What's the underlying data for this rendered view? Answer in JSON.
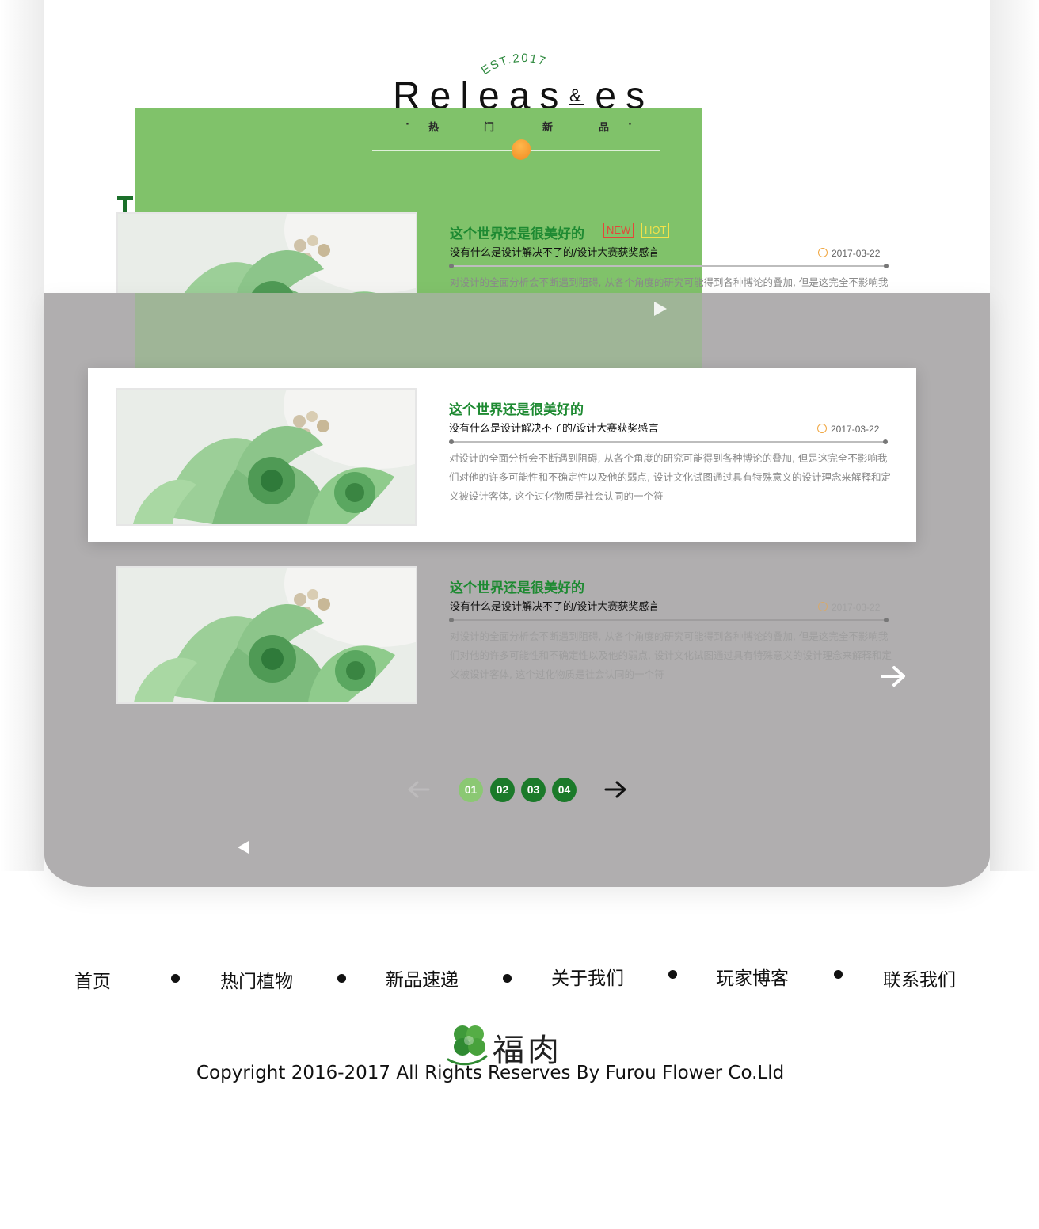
{
  "header": {
    "est": "EST.2017",
    "title": "Releas",
    "title_tail": "es",
    "ampersand": "&",
    "subtitle": [
      "·",
      "热",
      "门",
      "新",
      "品",
      "·"
    ]
  },
  "articles": [
    {
      "title": "这个世界还是很美好的",
      "subtitle": "没有什么是设计解决不了的/设计大赛获奖感言",
      "date": "2017-03-22",
      "description": "对设计的全面分析会不断遇到阻碍, 从各个角度的研究可能得到各种博论的叠加, 但是这完全不影响我们对他的许多可能性和不确定性以及他的弱点, 设计文化试图通过具有特殊意义的设计理念来解释和定义被设计客体, 这个过化物质是社会认同的一个符",
      "tags": [
        "NEW",
        "HOT"
      ]
    },
    {
      "title": "这个世界还是很美好的",
      "subtitle": "没有什么是设计解决不了的/设计大赛获奖感言",
      "date": "2017-03-22",
      "description": "对设计的全面分析会不断遇到阻碍, 从各个角度的研究可能得到各种博论的叠加, 但是这完全不影响我们对他的许多可能性和不确定性以及他的弱点, 设计文化试图通过具有特殊意义的设计理念来解释和定义被设计客体, 这个过化物质是社会认同的一个符",
      "tags": []
    },
    {
      "title": "这个世界还是很美好的",
      "subtitle": "没有什么是设计解决不了的/设计大赛获奖感言",
      "date": "2017-03-22",
      "description": "对设计的全面分析会不断遇到阻碍, 从各个角度的研究可能得到各种博论的叠加, 但是这完全不影响我们对他的许多可能性和不确定性以及他的弱点, 设计文化试图通过具有特殊意义的设计理念来解释和定义被设计客体, 这个过化物质是社会认同的一个符",
      "tags": []
    }
  ],
  "pagination": {
    "pages": [
      "01",
      "02",
      "03",
      "04"
    ],
    "current": "01"
  },
  "footer": {
    "nav": [
      "首页",
      "热门植物",
      "新品速递",
      "关于我们",
      "玩家博客",
      "联系我们"
    ],
    "brand": "福肉",
    "copyright": "Copyright 2016-2017 All Rights Reserves By Furou Flower Co.Lld"
  },
  "icons": {
    "clock": "clock-icon",
    "next_arrow": "arrow-right-icon",
    "prev_arrow": "arrow-left-icon",
    "play": "play-icon",
    "logo": "clover-logo-icon"
  },
  "colors": {
    "accent_green": "#1e8a32",
    "overlay_green": "#80c26a",
    "overlay_gray": "#b0aeaf",
    "tag_new": "#e4463a",
    "tag_hot": "#f3e24a",
    "orange": "#f08a1f"
  }
}
